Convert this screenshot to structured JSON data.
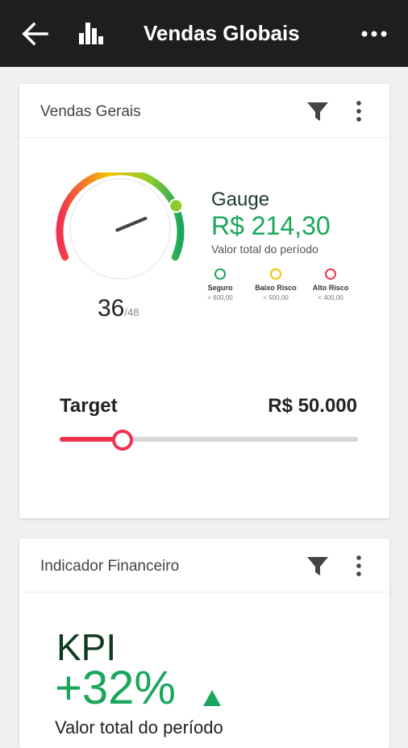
{
  "appbar": {
    "title": "Vendas Globais",
    "icons": [
      "arrow-back-icon",
      "bar-chart-icon",
      "more-horizontal-icon"
    ]
  },
  "card1": {
    "title": "Vendas Gerais",
    "gauge": {
      "value": "36",
      "max": "/48",
      "level": 0.75
    },
    "heading": "Gauge",
    "amount": "R$ 214,30",
    "subtitle": "Valor total do período",
    "legend": [
      {
        "label": "Seguro",
        "range": "< 600,00",
        "color": "#1aa65c"
      },
      {
        "label": "Baixo Risco",
        "range": "< 500,00",
        "color": "#f2c200"
      },
      {
        "label": "Alto Risco",
        "range": "< 400,00",
        "color": "#f0314f"
      }
    ],
    "target": {
      "label": "Target",
      "value": "R$ 50.000",
      "level": 0.21
    }
  },
  "card2": {
    "title": "Indicador Financeiro",
    "kpi_label": "KPI",
    "kpi_value": "+32%",
    "subtitle": "Valor total do período"
  },
  "colors": {
    "appbar": "#1e1e1e",
    "green": "#1aa65c",
    "yellow": "#f2c200",
    "red": "#f0314f"
  }
}
